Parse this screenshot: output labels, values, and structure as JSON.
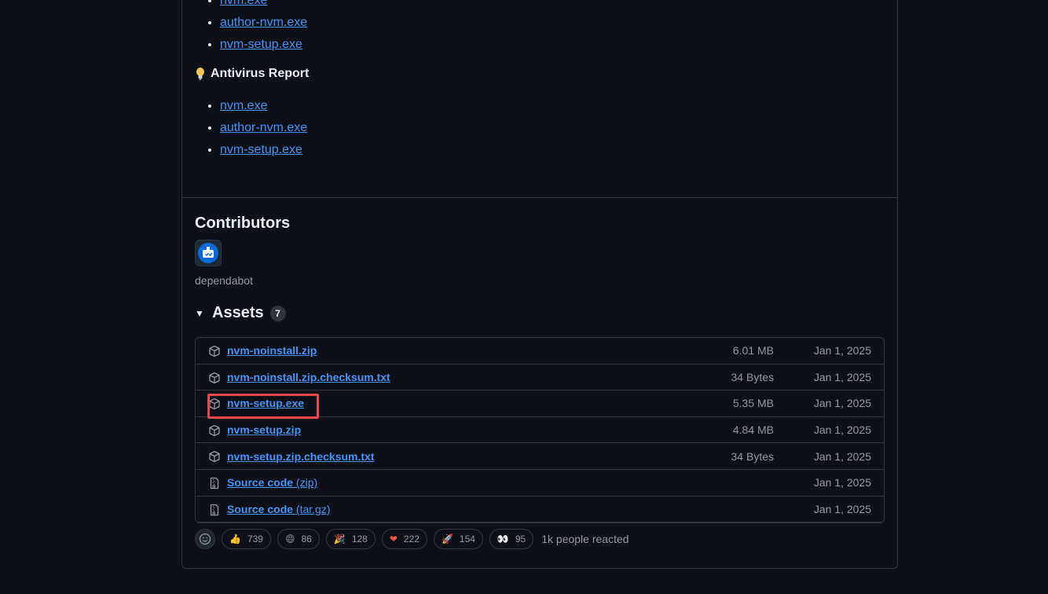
{
  "top_links": [
    "nvm.exe",
    "author-nvm.exe",
    "nvm-setup.exe"
  ],
  "antivirus": {
    "title": "Antivirus Report",
    "links": [
      "nvm.exe",
      "author-nvm.exe",
      "nvm-setup.exe"
    ]
  },
  "contributors": {
    "title": "Contributors",
    "users": [
      {
        "name": "dependabot"
      }
    ]
  },
  "assets": {
    "title": "Assets",
    "count": "7",
    "rows": [
      {
        "name": "nvm-noinstall.zip",
        "size": "6.01 MB",
        "date": "Jan 1, 2025",
        "icon": "package-icon"
      },
      {
        "name": "nvm-noinstall.zip.checksum.txt",
        "size": "34 Bytes",
        "date": "Jan 1, 2025",
        "icon": "package-icon"
      },
      {
        "name": "nvm-setup.exe",
        "size": "5.35 MB",
        "date": "Jan 1, 2025",
        "icon": "package-icon",
        "highlighted": true
      },
      {
        "name": "nvm-setup.zip",
        "size": "4.84 MB",
        "date": "Jan 1, 2025",
        "icon": "package-icon"
      },
      {
        "name": "nvm-setup.zip.checksum.txt",
        "size": "34 Bytes",
        "date": "Jan 1, 2025",
        "icon": "package-icon"
      },
      {
        "name": "Source code",
        "sub": "(zip)",
        "size": "",
        "date": "Jan 1, 2025",
        "icon": "file-zip-icon"
      },
      {
        "name": "Source code",
        "sub": "(tar.gz)",
        "size": "",
        "date": "Jan 1, 2025",
        "icon": "file-zip-icon"
      }
    ]
  },
  "reactions": {
    "items": [
      {
        "emoji": "👍",
        "count": "739",
        "icon": "thumbs-up-icon"
      },
      {
        "emoji": "😄",
        "count": "86",
        "icon": "laugh-icon"
      },
      {
        "emoji": "🎉",
        "count": "128",
        "icon": "hooray-icon"
      },
      {
        "emoji": "❤",
        "count": "222",
        "icon": "heart-icon"
      },
      {
        "emoji": "🚀",
        "count": "154",
        "icon": "rocket-icon"
      },
      {
        "emoji": "👀",
        "count": "95",
        "icon": "eyes-icon"
      }
    ],
    "summary": "1k people reacted"
  },
  "colors": {
    "link": "#4493f8",
    "highlight": "#e5484d",
    "background": "#0d1117"
  }
}
